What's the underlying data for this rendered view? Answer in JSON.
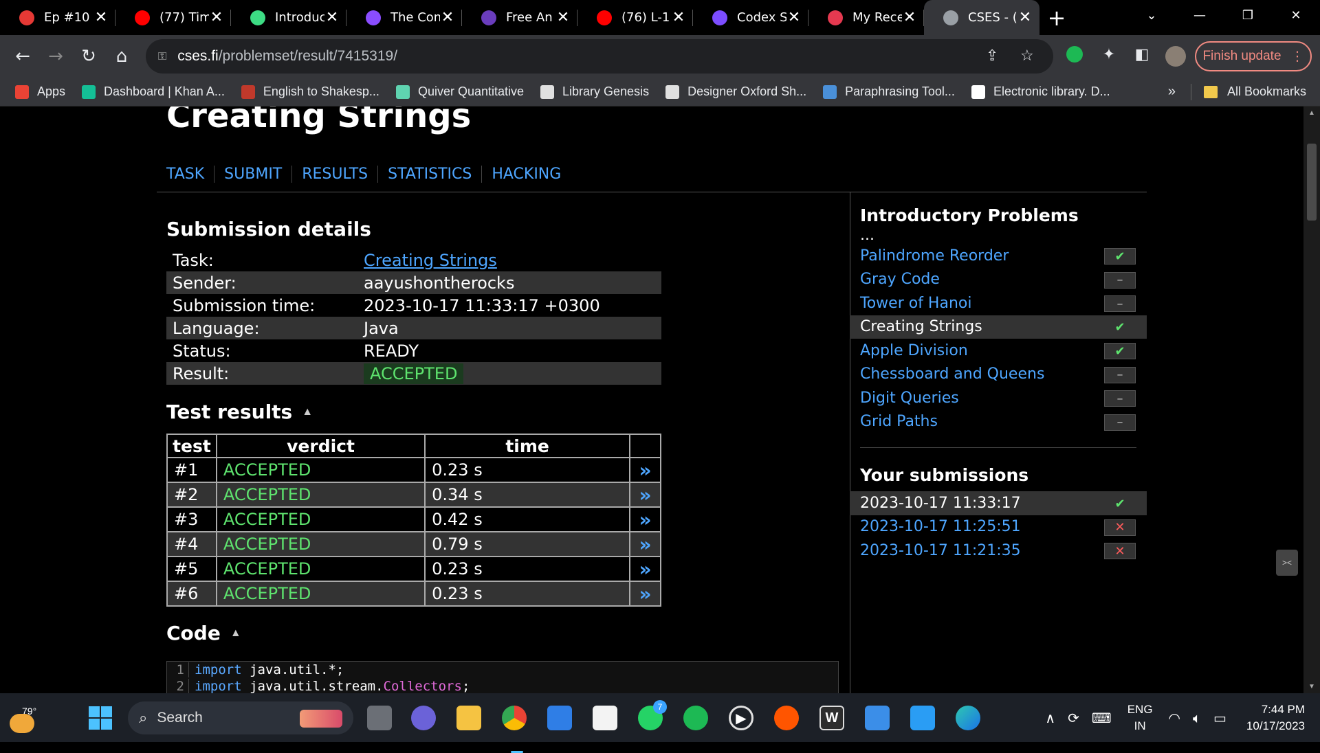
{
  "browser": {
    "tabs": [
      {
        "title": "Ep #10 |",
        "icon": "youtube-red-dot-icon",
        "color": "#e53935"
      },
      {
        "title": "(77) Tim",
        "icon": "youtube-icon",
        "color": "#ff0000"
      },
      {
        "title": "Introduc",
        "icon": "android-icon",
        "color": "#3ddc84"
      },
      {
        "title": "The Con",
        "icon": "purple-u-icon",
        "color": "#8a4dff"
      },
      {
        "title": "Free An",
        "icon": "purple-circle-icon",
        "color": "#6a3dbd"
      },
      {
        "title": "(76) L-1.",
        "icon": "youtube-icon",
        "color": "#ff0000"
      },
      {
        "title": "Codex S",
        "icon": "codex-icon",
        "color": "#7c4dff"
      },
      {
        "title": "My Rece",
        "icon": "red-circle-icon",
        "color": "#e53950"
      },
      {
        "title": "CSES - (",
        "icon": "globe-icon",
        "color": "#9aa0a6"
      }
    ],
    "active_tab": 8,
    "url_domain": "cses.fi",
    "url_path": "/problemset/result/7415319/",
    "finish_update": "Finish update",
    "bookmarks": [
      {
        "label": "Apps",
        "icon": "apps-grid-icon",
        "color": "#ea4335"
      },
      {
        "label": "Dashboard | Khan A...",
        "icon": "khan-academy-icon",
        "color": "#14bf96"
      },
      {
        "label": "English to Shakesp...",
        "icon": "shakespeare-icon",
        "color": "#c0392b"
      },
      {
        "label": "Quiver Quantitative",
        "icon": "quiver-icon",
        "color": "#5fd3b0"
      },
      {
        "label": "Library Genesis",
        "icon": "library-icon",
        "color": "#e0e0e0"
      },
      {
        "label": "Designer Oxford Sh...",
        "icon": "designer-f-icon",
        "color": "#e0e0e0"
      },
      {
        "label": "Paraphrasing Tool...",
        "icon": "paraphrase-icon",
        "color": "#4a90d9"
      },
      {
        "label": "Electronic library. D...",
        "icon": "v-library-icon",
        "color": "#ffffff"
      }
    ],
    "all_bookmarks": "All Bookmarks",
    "overflow": "»"
  },
  "page": {
    "title": "Creating Strings",
    "nav": [
      "TASK",
      "SUBMIT",
      "RESULTS",
      "STATISTICS",
      "HACKING"
    ],
    "submission_heading": "Submission details",
    "details": {
      "task_label": "Task:",
      "task_value": "Creating Strings",
      "sender_label": "Sender:",
      "sender_value": "aayushontherocks",
      "time_label": "Submission time:",
      "time_value": "2023-10-17 11:33:17 +0300",
      "lang_label": "Language:",
      "lang_value": "Java",
      "status_label": "Status:",
      "status_value": "READY",
      "result_label": "Result:",
      "result_value": "ACCEPTED"
    },
    "tests_heading": "Test results",
    "tests_columns": [
      "test",
      "verdict",
      "time"
    ],
    "tests": [
      {
        "id": "#1",
        "verdict": "ACCEPTED",
        "time": "0.23 s"
      },
      {
        "id": "#2",
        "verdict": "ACCEPTED",
        "time": "0.34 s"
      },
      {
        "id": "#3",
        "verdict": "ACCEPTED",
        "time": "0.42 s"
      },
      {
        "id": "#4",
        "verdict": "ACCEPTED",
        "time": "0.79 s"
      },
      {
        "id": "#5",
        "verdict": "ACCEPTED",
        "time": "0.23 s"
      },
      {
        "id": "#6",
        "verdict": "ACCEPTED",
        "time": "0.23 s"
      }
    ],
    "tests_link_glyph": "»",
    "code_heading": "Code",
    "code_lines": [
      {
        "no": "1",
        "kw": "import",
        "rest": " java.util.*;",
        "cls": ""
      },
      {
        "no": "2",
        "kw": "import",
        "rest": " java.util.stream.",
        "cls": "Collectors",
        "tail": ";"
      }
    ]
  },
  "sidebar": {
    "section_title": "Introductory Problems",
    "ellipsis": "...",
    "problems": [
      {
        "name": "Palindrome Reorder",
        "status": "ok"
      },
      {
        "name": "Gray Code",
        "status": "none"
      },
      {
        "name": "Tower of Hanoi",
        "status": "none"
      },
      {
        "name": "Creating Strings",
        "status": "ok",
        "current": true
      },
      {
        "name": "Apple Division",
        "status": "ok"
      },
      {
        "name": "Chessboard and Queens",
        "status": "none"
      },
      {
        "name": "Digit Queries",
        "status": "none"
      },
      {
        "name": "Grid Paths",
        "status": "none"
      }
    ],
    "submissions_title": "Your submissions",
    "submissions": [
      {
        "time": "2023-10-17 11:33:17",
        "status": "ok",
        "current": true
      },
      {
        "time": "2023-10-17 11:25:51",
        "status": "bad"
      },
      {
        "time": "2023-10-17 11:21:35",
        "status": "bad"
      }
    ],
    "status_glyphs": {
      "ok": "✔",
      "none": "–",
      "bad": "✕"
    }
  },
  "taskbar": {
    "weather": "79°",
    "search": "Search",
    "whatsapp_badge": "7",
    "lang_top": "ENG",
    "lang_bottom": "IN",
    "time": "7:44 PM",
    "date": "10/17/2023"
  }
}
